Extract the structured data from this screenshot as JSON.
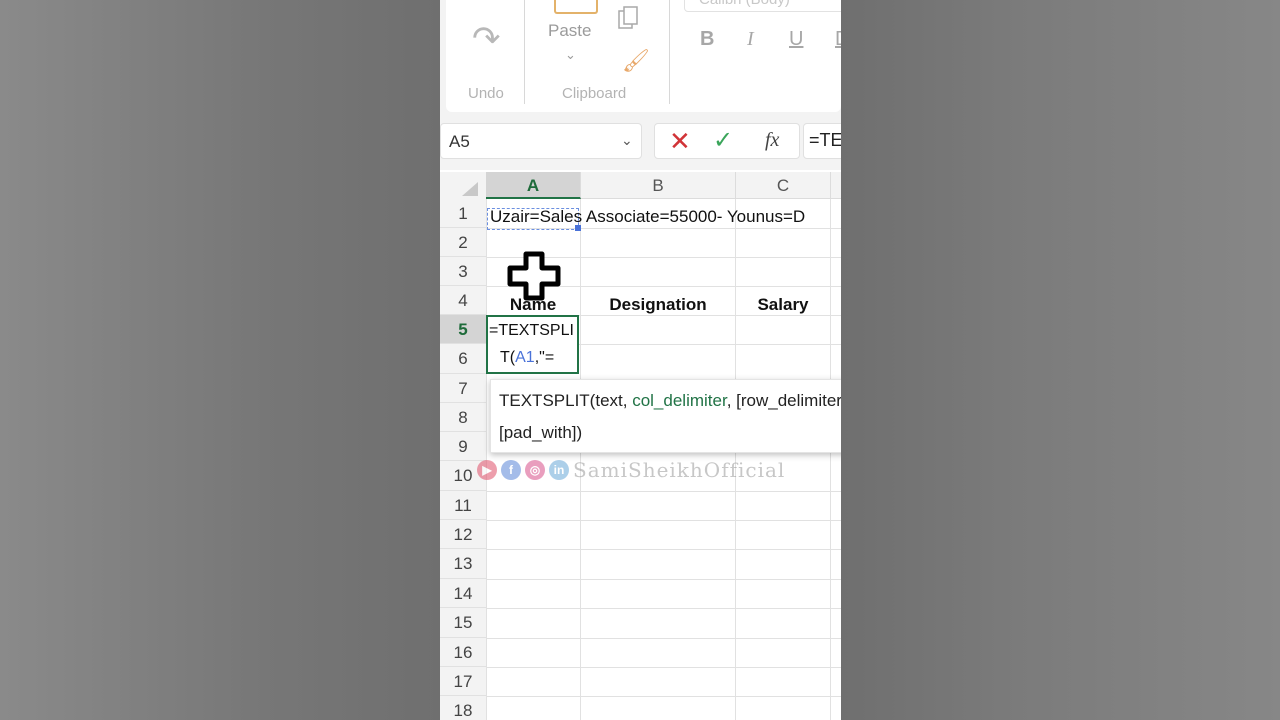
{
  "ribbon": {
    "undo_label": "Undo",
    "paste_label": "Paste",
    "clipboard_label": "Clipboard",
    "font_name": "Calibri (Body)",
    "bold": "B",
    "italic": "I",
    "underline": "U",
    "double_underline": "D"
  },
  "formula_bar": {
    "name_box": "A5",
    "fx": "fx",
    "formula": "=TE"
  },
  "columns": [
    "A",
    "B",
    "C"
  ],
  "rows": [
    "1",
    "2",
    "3",
    "4",
    "5",
    "6",
    "7",
    "8",
    "9",
    "10",
    "11",
    "12",
    "13",
    "14",
    "15",
    "16",
    "17",
    "18"
  ],
  "cells": {
    "a1": "Uzair=Sales Associate=55000- Younus=D",
    "a4": "Name",
    "b4": "Designation",
    "c4": "Salary"
  },
  "editing": {
    "line1": "=TEXTSPLI",
    "line2_prefix": "T(",
    "line2_ref": "A1",
    "line2_suffix": ",\"="
  },
  "tooltip": {
    "fn": "TEXTSPLIT(text, ",
    "current_arg": "col_delimiter",
    "rest": ", [row_delimiter]",
    "line2": "[pad_with])"
  },
  "watermark": {
    "text": "SamiSheikhOfficial",
    "icons": [
      "youtube-icon",
      "facebook-icon",
      "instagram-icon",
      "linkedin-icon"
    ]
  },
  "colors": {
    "accent": "#217346",
    "reference": "#4a72d8",
    "cancel": "#d13438",
    "enter": "#3aa55a"
  }
}
